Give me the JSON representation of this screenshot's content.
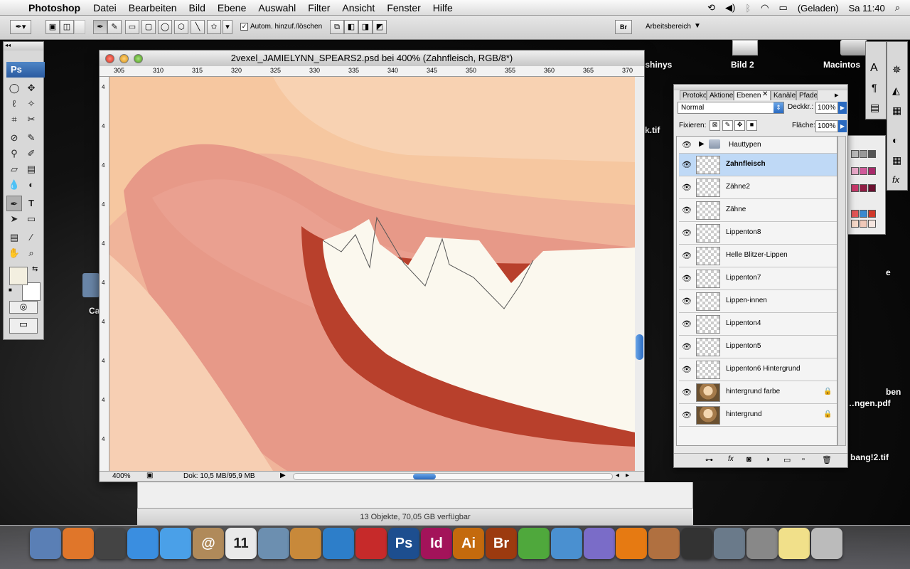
{
  "menubar": {
    "app": "Photoshop",
    "items": [
      "Datei",
      "Bearbeiten",
      "Bild",
      "Ebene",
      "Auswahl",
      "Filter",
      "Ansicht",
      "Fenster",
      "Hilfe"
    ],
    "battery": "(Geladen)",
    "clock": "Sa 11:40"
  },
  "optbar": {
    "auto_add_label": "Autom. hinzuf./löschen",
    "workspace_label": "Arbeitsbereich",
    "bridge_label": "Br"
  },
  "toolbox": {
    "badge": "Ps"
  },
  "document": {
    "title": "2vexel_JAMIELYNN_SPEARS2.psd bei 400% (Zahnfleisch, RGB/8*)",
    "zoom": "400%",
    "doc_size": "Dok: 10,5 MB/95,9 MB",
    "ruler_h": [
      "305",
      "310",
      "315",
      "320",
      "325",
      "330",
      "335",
      "340",
      "345",
      "350",
      "355",
      "360",
      "365",
      "370"
    ],
    "ruler_v": [
      "4",
      "4",
      "4",
      "4",
      "4",
      "4",
      "4",
      "4",
      "4",
      "4"
    ]
  },
  "layers_panel": {
    "tabs": [
      "Protokoll",
      "Aktionen",
      "Ebenen",
      "Kanäle",
      "Pfade"
    ],
    "blend_mode": "Normal",
    "opacity_label": "Deckkr.:",
    "opacity": "100%",
    "lock_label": "Fixieren:",
    "fill_label": "Fläche:",
    "fill": "100%",
    "group": "Hauttypen",
    "layers": [
      {
        "name": "Zahnfleisch",
        "selected": true,
        "locked": false
      },
      {
        "name": "Zähne2",
        "selected": false,
        "locked": false
      },
      {
        "name": "Zähne",
        "selected": false,
        "locked": false
      },
      {
        "name": "Lippenton8",
        "selected": false,
        "locked": false
      },
      {
        "name": "Helle Blitzer-Lippen",
        "selected": false,
        "locked": false
      },
      {
        "name": "Lippenton7",
        "selected": false,
        "locked": false
      },
      {
        "name": "Lippen-innen",
        "selected": false,
        "locked": false
      },
      {
        "name": "Lippenton4",
        "selected": false,
        "locked": false
      },
      {
        "name": "Lippenton5",
        "selected": false,
        "locked": false
      },
      {
        "name": "Lippenton6 Hintergrund",
        "selected": false,
        "locked": false
      },
      {
        "name": "hintergrund farbe",
        "selected": false,
        "locked": true
      },
      {
        "name": "hintergrund",
        "selected": false,
        "locked": true
      }
    ]
  },
  "finder": {
    "status": "13 Objekte, 70,05 GB verfügbar"
  },
  "desktop": {
    "items": [
      "ushinys",
      "Bild 2",
      "Macintos",
      "k.tif",
      "ben",
      "…ngen.pdf",
      "bang!2.tif",
      "Ca",
      "e"
    ]
  },
  "dock": {
    "items": [
      {
        "label": "",
        "color": "#5a7fb5",
        "icon": "finder-icon"
      },
      {
        "label": "",
        "color": "#e0762a",
        "icon": "firefox-icon"
      },
      {
        "label": "",
        "color": "#444",
        "icon": "dashboard-icon"
      },
      {
        "label": "",
        "color": "#3a8ee0",
        "icon": "safari-icon"
      },
      {
        "label": "",
        "color": "#4aa0e8",
        "icon": "ichat-icon"
      },
      {
        "label": "@",
        "color": "#b08a5a",
        "icon": "addressbook-icon"
      },
      {
        "label": "11",
        "color": "#e9e9e9",
        "icon": "ical-icon"
      },
      {
        "label": "",
        "color": "#6c8fb0",
        "icon": "iphoto-icon"
      },
      {
        "label": "",
        "color": "#c8893a",
        "icon": "photobooth-icon"
      },
      {
        "label": "",
        "color": "#2d7ec9",
        "icon": "itunes-icon"
      },
      {
        "label": "",
        "color": "#c62a2a",
        "icon": "acrobat-icon"
      },
      {
        "label": "Ps",
        "color": "#1d4e8f",
        "icon": "photoshop-icon"
      },
      {
        "label": "Id",
        "color": "#a3135a",
        "icon": "indesign-icon"
      },
      {
        "label": "Ai",
        "color": "#c46a0d",
        "icon": "illustrator-icon"
      },
      {
        "label": "Br",
        "color": "#9c3a0f",
        "icon": "bridge-icon"
      },
      {
        "label": "",
        "color": "#4fa83c",
        "icon": "adium-icon"
      },
      {
        "label": "",
        "color": "#4a90d0",
        "icon": "messenger-icon"
      },
      {
        "label": "",
        "color": "#7a6cc8",
        "icon": "spaces-icon"
      },
      {
        "label": "",
        "color": "#e67a12",
        "icon": "vlc-icon"
      },
      {
        "label": "",
        "color": "#b07040",
        "icon": "garageband-icon"
      },
      {
        "label": "",
        "color": "#333",
        "icon": "imovie-icon"
      },
      {
        "label": "",
        "color": "#6a7a8a",
        "icon": "expose-icon"
      },
      {
        "label": "",
        "color": "#888",
        "icon": "systemprefs-icon"
      },
      {
        "label": "",
        "color": "#f1e08a",
        "icon": "stickies-icon"
      },
      {
        "label": "",
        "color": "#bbb",
        "icon": "trash-icon"
      }
    ]
  }
}
